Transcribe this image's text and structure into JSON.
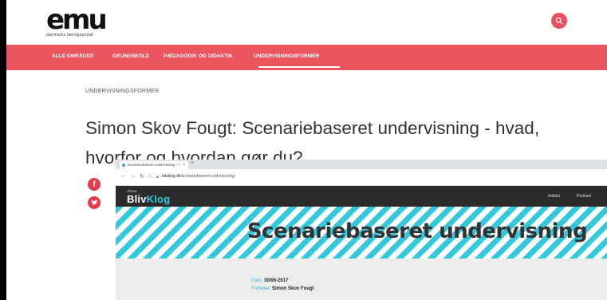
{
  "header": {
    "logo_text": "emu",
    "logo_tagline": "danmarks læringsportal",
    "search_icon": "search-icon"
  },
  "nav": {
    "items": [
      "ALLE OMRÅDER",
      "GRUNDSKOLE",
      "PÆDAGOGIK OG DIDAKTIK",
      "UNDERVISNINGSFORMER"
    ],
    "active": "UNDERVISNINGSFORMER"
  },
  "article": {
    "category": "UNDERVISNINGSFORMER",
    "title": "Simon Skov Fougt: Scenariebaseret undervisning - hvad, hvorfor og hvordan gør du?"
  },
  "share": {
    "facebook_icon": "facebook-icon",
    "twitter_icon": "twitter-icon"
  },
  "embedded_browser": {
    "tab_title": "Scenariebaseret undervisning – l",
    "tab_close": "×",
    "new_tab": "+",
    "url_domain": "blivklog.dk",
    "url_path": "/scenariebaseret-undervisning/",
    "site": {
      "brand_small": "Alinea",
      "brand_a": "Bliv",
      "brand_b": "Klog",
      "links": [
        "Artikler",
        "Podcast"
      ],
      "hero_title": "Scenariebaseret undervisning",
      "date_label": "Dato:",
      "date_value": "30/06-2017",
      "author_label": "Forfatter:",
      "author_value": "Simon Skov Fougt"
    }
  },
  "colors": {
    "brand_red": "#ea5560",
    "accent_cyan": "#34c8dd",
    "dark": "#2b2b2b"
  }
}
